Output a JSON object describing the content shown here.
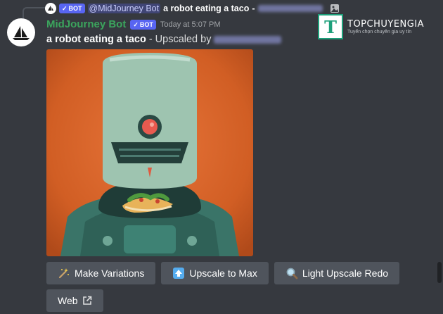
{
  "reply": {
    "mention": "@MidJourney Bot",
    "text": "a robot eating a taco",
    "dash": "-"
  },
  "message": {
    "username": "MidJourney Bot",
    "bot_tag": "BOT",
    "timestamp": "Today at 5:07 PM",
    "prompt": "a robot eating a taco",
    "suffix": "- Upscaled by"
  },
  "buttons": {
    "make_variations": "Make Variations",
    "upscale_to_max": "Upscale to Max",
    "light_upscale_redo": "Light Upscale Redo",
    "web": "Web"
  },
  "watermark": {
    "letter": "T",
    "title": "TOPCHUYENGIA",
    "subtitle": "Tuyển chọn chuyên gia uy tín"
  },
  "colors": {
    "background": "#36393f",
    "username": "#3ba55d",
    "bot_tag": "#5865f2",
    "button": "#4f545c",
    "artwork_bg": "#d8642a",
    "robot_body": "#9ec4b0"
  }
}
